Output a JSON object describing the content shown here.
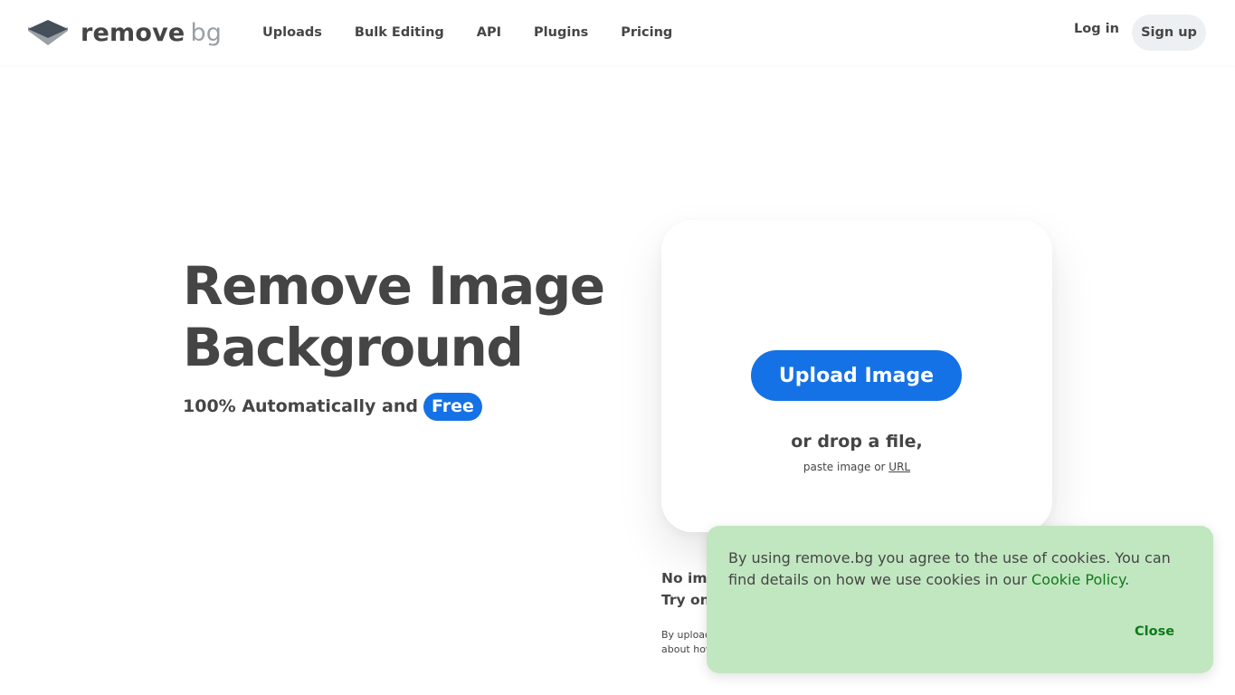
{
  "header": {
    "logo": {
      "remove": "remove",
      "bg": "bg"
    },
    "nav": [
      {
        "label": "Uploads"
      },
      {
        "label": "Bulk Editing"
      },
      {
        "label": "API"
      },
      {
        "label": "Plugins"
      },
      {
        "label": "Pricing"
      }
    ],
    "login_label": "Log in",
    "signup_label": "Sign up"
  },
  "hero": {
    "title_line1": "Remove Image",
    "title_line2": "Background",
    "subtitle_prefix": "100% Automatically and",
    "subtitle_badge": "Free"
  },
  "upload": {
    "button_label": "Upload Image",
    "drop_text": "or drop a file,",
    "paste_text": "paste image or",
    "url_link": "URL"
  },
  "below": {
    "no_image_line1": "No ima",
    "no_image_line2": "Try one",
    "terms_line1": "By upload",
    "terms_line2": "about how"
  },
  "cookie": {
    "text": "By using remove.bg you agree to the use of cookies. You can find details on how we use cookies in our",
    "policy_link": "Cookie Policy",
    "period": ".",
    "close_label": "Close"
  },
  "colors": {
    "accent": "#1571e6",
    "text": "#454545",
    "cookie_bg": "#c1e7c1",
    "cookie_link": "#0f7a1a",
    "signup_bg": "#edf0f2"
  }
}
